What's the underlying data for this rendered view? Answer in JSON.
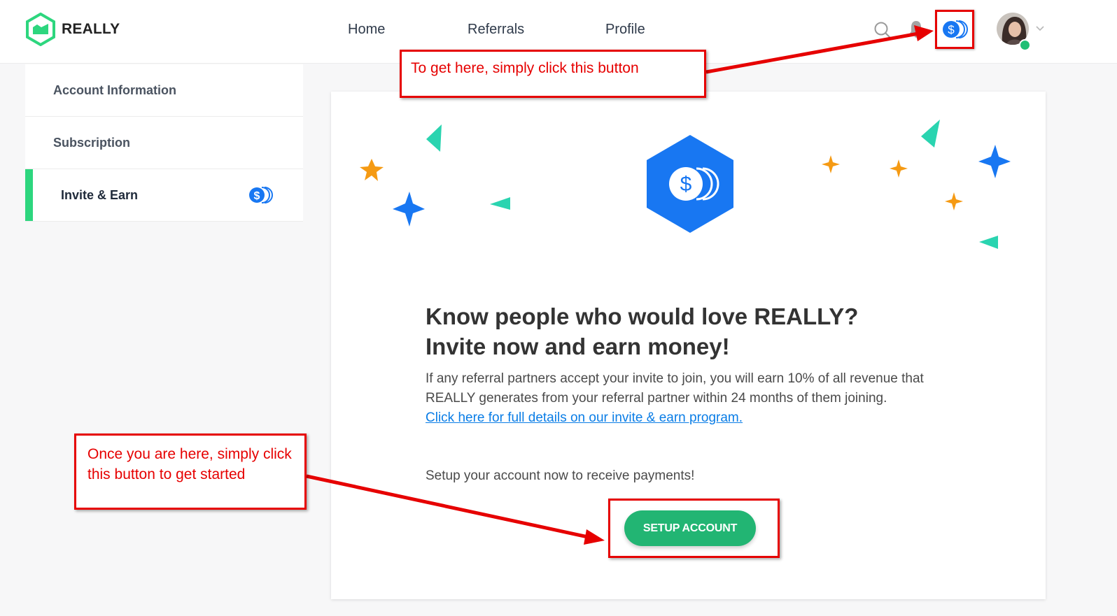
{
  "brand": {
    "name": "REALLY"
  },
  "nav": {
    "home": "Home",
    "referrals": "Referrals",
    "profile": "Profile"
  },
  "sidebar": {
    "items": [
      {
        "label": "Account Information"
      },
      {
        "label": "Subscription"
      },
      {
        "label": "Invite & Earn"
      }
    ]
  },
  "main": {
    "headline_line1": "Know people who would love REALLY?",
    "headline_line2": "Invite now and earn money!",
    "description": "If any referral partners accept your invite to join, you will earn 10% of all revenue that REALLY generates from your referral partner within 24 months of them joining.",
    "details_link": "Click here for full details on our invite & earn program.",
    "setup_prompt": "Setup your account now to receive payments!",
    "setup_button": "SETUP ACCOUNT"
  },
  "annotations": {
    "top": "To get here, simply click this button",
    "bottom": "Once you are here, simply click this button to get started"
  },
  "colors": {
    "brand_green": "#2dd67e",
    "coin_blue": "#1877f2",
    "cta_green": "#22b573",
    "annotation_red": "#e60000",
    "link_blue": "#0a7de6"
  },
  "icons": [
    "logo-icon",
    "search-icon",
    "bell-icon",
    "coin-icon",
    "avatar",
    "chevron-down-icon"
  ]
}
